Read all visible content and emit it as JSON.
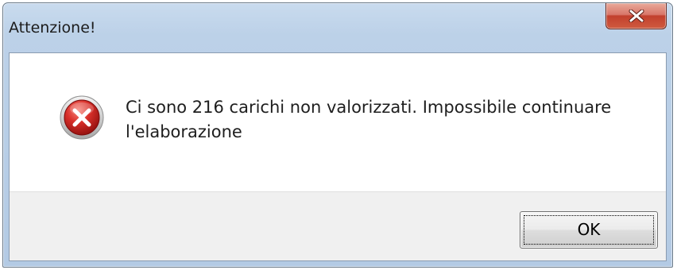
{
  "dialog": {
    "title": "Attenzione!",
    "close_icon": "close-x-icon",
    "icon": "error-icon",
    "message": "Ci sono 216 carichi non valorizzati. Impossibile continuare l'elaborazione",
    "ok_label": "OK"
  },
  "colors": {
    "error_red": "#d9302a",
    "close_button_red": "#c2402d",
    "frame_blue": "#bcd1e8",
    "footer_gray": "#f0f0f0"
  }
}
